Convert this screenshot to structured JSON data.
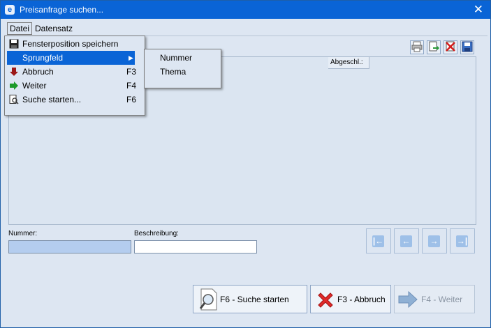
{
  "window": {
    "title": "Preisanfrage suchen...",
    "icon": "app-icon",
    "close_glyph": "✕"
  },
  "menubar": {
    "items": [
      {
        "label": "Datei",
        "active": true
      },
      {
        "label": "Datensatz",
        "active": false
      }
    ]
  },
  "dropdown": {
    "items": [
      {
        "label": "Fensterposition speichern",
        "shortcut": "",
        "icon": "floppy-disk-icon",
        "highlighted": false,
        "submenu": false
      },
      {
        "label": "Sprungfeld",
        "shortcut": "",
        "icon": "",
        "highlighted": true,
        "submenu": true
      },
      {
        "label": "Abbruch",
        "shortcut": "F3",
        "icon": "arrow-down-icon",
        "highlighted": false,
        "submenu": false
      },
      {
        "label": "Weiter",
        "shortcut": "F4",
        "icon": "arrow-right-icon",
        "highlighted": false,
        "submenu": false
      },
      {
        "label": "Suche starten...",
        "shortcut": "F6",
        "icon": "search-doc-icon",
        "highlighted": false,
        "submenu": false
      }
    ]
  },
  "submenu": {
    "items": [
      {
        "label": "Nummer"
      },
      {
        "label": "Thema"
      }
    ]
  },
  "toolbar": {
    "icons": [
      "printer-icon",
      "export-icon",
      "delete-icon",
      "save-icon"
    ]
  },
  "grid": {
    "columns": [
      {
        "label": "Abgeschl.:"
      }
    ]
  },
  "fields": {
    "nummer_label": "Nummer:",
    "nummer_value": "",
    "beschreibung_label": "Beschreibung:",
    "beschreibung_value": ""
  },
  "navigation": {
    "buttons": [
      "first-icon",
      "prev-icon",
      "next-icon",
      "last-icon"
    ]
  },
  "buttons": {
    "search_label": "F6 - Suche starten",
    "cancel_label": "F3 - Abbruch",
    "next_label": "F4 - Weiter",
    "next_enabled": false
  },
  "colors": {
    "titlebar": "#0a64d6",
    "highlight": "#0a64d6",
    "window_bg": "#dde6f2",
    "input_focus": "#b4cdef"
  }
}
